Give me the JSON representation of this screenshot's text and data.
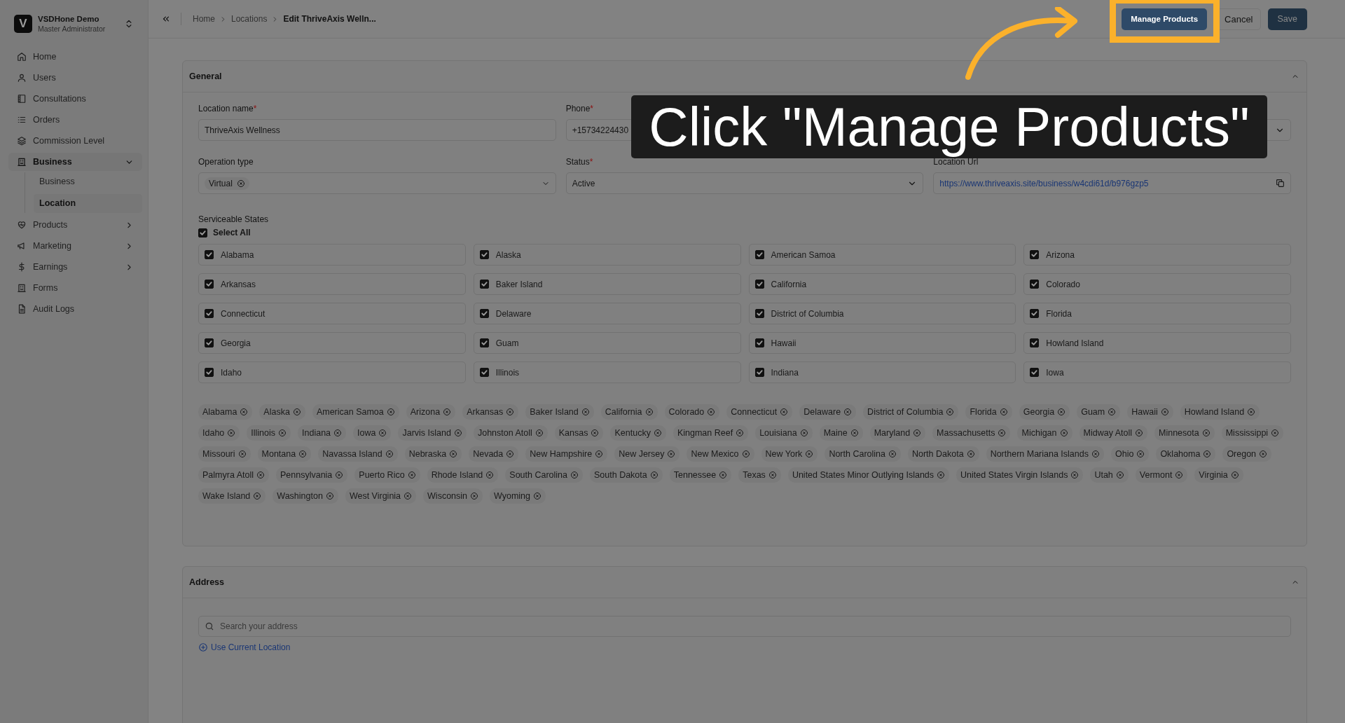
{
  "sidebar": {
    "org": {
      "initial": "V",
      "name": "VSDHone Demo",
      "role": "Master Administrator"
    },
    "items": [
      {
        "label": "Home",
        "kind": "link",
        "selected": false
      },
      {
        "label": "Users",
        "kind": "link",
        "selected": false
      },
      {
        "label": "Consultations",
        "kind": "link",
        "selected": false
      },
      {
        "label": "Orders",
        "kind": "link",
        "selected": false
      },
      {
        "label": "Commission Level",
        "kind": "link",
        "selected": false
      },
      {
        "label": "Business",
        "kind": "group",
        "selected": true,
        "expanded": true,
        "children": [
          {
            "label": "Business",
            "selected": false
          },
          {
            "label": "Location",
            "selected": true
          }
        ]
      },
      {
        "label": "Products",
        "kind": "group",
        "selected": false,
        "expanded": false
      },
      {
        "label": "Marketing",
        "kind": "group",
        "selected": false,
        "expanded": false
      },
      {
        "label": "Earnings",
        "kind": "group",
        "selected": false,
        "expanded": false
      },
      {
        "label": "Forms",
        "kind": "link",
        "selected": false
      },
      {
        "label": "Audit Logs",
        "kind": "link",
        "selected": false
      }
    ]
  },
  "breadcrumb": [
    "Home",
    "Locations",
    "Edit ThriveAxis Welln..."
  ],
  "actions": [
    {
      "label": "Manage Products",
      "kind": "primary",
      "highlighted": true
    },
    {
      "label": "Cancel",
      "kind": "plain",
      "highlighted": false
    },
    {
      "label": "Save",
      "kind": "primary",
      "highlighted": false
    }
  ],
  "general": {
    "title": "General",
    "expanded": true,
    "fields": [
      {
        "kind": "text",
        "label": "Location name",
        "required_mark": "*",
        "value": "ThriveAxis Wellness"
      },
      {
        "kind": "text",
        "label": "Phone",
        "required_mark": "*",
        "value": "+15734224430"
      },
      {
        "kind": "select"
      },
      {
        "kind": "chips",
        "label": "Operation type",
        "chips": [
          "Virtual"
        ]
      },
      {
        "kind": "select",
        "label": "Status",
        "required_mark": "*",
        "value": "Active"
      },
      {
        "kind": "link",
        "label": "Location Url",
        "value": "https://www.thriveaxis.site/business/w4cdi61d/b976gzp5"
      }
    ],
    "serviceable_states": {
      "label": "Serviceable States",
      "select_all": {
        "label": "Select All",
        "checked": true
      },
      "options": [
        {
          "label": "Alabama",
          "checked": true
        },
        {
          "label": "Alaska",
          "checked": true
        },
        {
          "label": "American Samoa",
          "checked": true
        },
        {
          "label": "Arizona",
          "checked": true
        },
        {
          "label": "Arkansas",
          "checked": true
        },
        {
          "label": "Baker Island",
          "checked": true
        },
        {
          "label": "California",
          "checked": true
        },
        {
          "label": "Colorado",
          "checked": true
        },
        {
          "label": "Connecticut",
          "checked": true
        },
        {
          "label": "Delaware",
          "checked": true
        },
        {
          "label": "District of Columbia",
          "checked": true
        },
        {
          "label": "Florida",
          "checked": true
        },
        {
          "label": "Georgia",
          "checked": true
        },
        {
          "label": "Guam",
          "checked": true
        },
        {
          "label": "Hawaii",
          "checked": true
        },
        {
          "label": "Howland Island",
          "checked": true
        },
        {
          "label": "Idaho",
          "checked": true
        },
        {
          "label": "Illinois",
          "checked": true
        },
        {
          "label": "Indiana",
          "checked": true
        },
        {
          "label": "Iowa",
          "checked": true
        }
      ],
      "tags": [
        "Alabama",
        "Alaska",
        "American Samoa",
        "Arizona",
        "Arkansas",
        "Baker Island",
        "California",
        "Colorado",
        "Connecticut",
        "Delaware",
        "District of Columbia",
        "Florida",
        "Georgia",
        "Guam",
        "Hawaii",
        "Howland Island",
        "Idaho",
        "Illinois",
        "Indiana",
        "Iowa",
        "Jarvis Island",
        "Johnston Atoll",
        "Kansas",
        "Kentucky",
        "Kingman Reef",
        "Louisiana",
        "Maine",
        "Maryland",
        "Massachusetts",
        "Michigan",
        "Midway Atoll",
        "Minnesota",
        "Mississippi",
        "Missouri",
        "Montana",
        "Navassa Island",
        "Nebraska",
        "Nevada",
        "New Hampshire",
        "New Jersey",
        "New Mexico",
        "New York",
        "North Carolina",
        "North Dakota",
        "Northern Mariana Islands",
        "Ohio",
        "Oklahoma",
        "Oregon",
        "Palmyra Atoll",
        "Pennsylvania",
        "Puerto Rico",
        "Rhode Island",
        "South Carolina",
        "South Dakota",
        "Tennessee",
        "Texas",
        "United States Minor Outlying Islands",
        "United States Virgin Islands",
        "Utah",
        "Vermont",
        "Virginia",
        "Wake Island",
        "Washington",
        "West Virginia",
        "Wisconsin",
        "Wyoming"
      ]
    }
  },
  "address": {
    "title": "Address",
    "expanded": true,
    "search": {
      "placeholder": "Search your address"
    },
    "use_location": "Use Current Location"
  },
  "callout": {
    "text": "Click \"Manage Products\""
  }
}
